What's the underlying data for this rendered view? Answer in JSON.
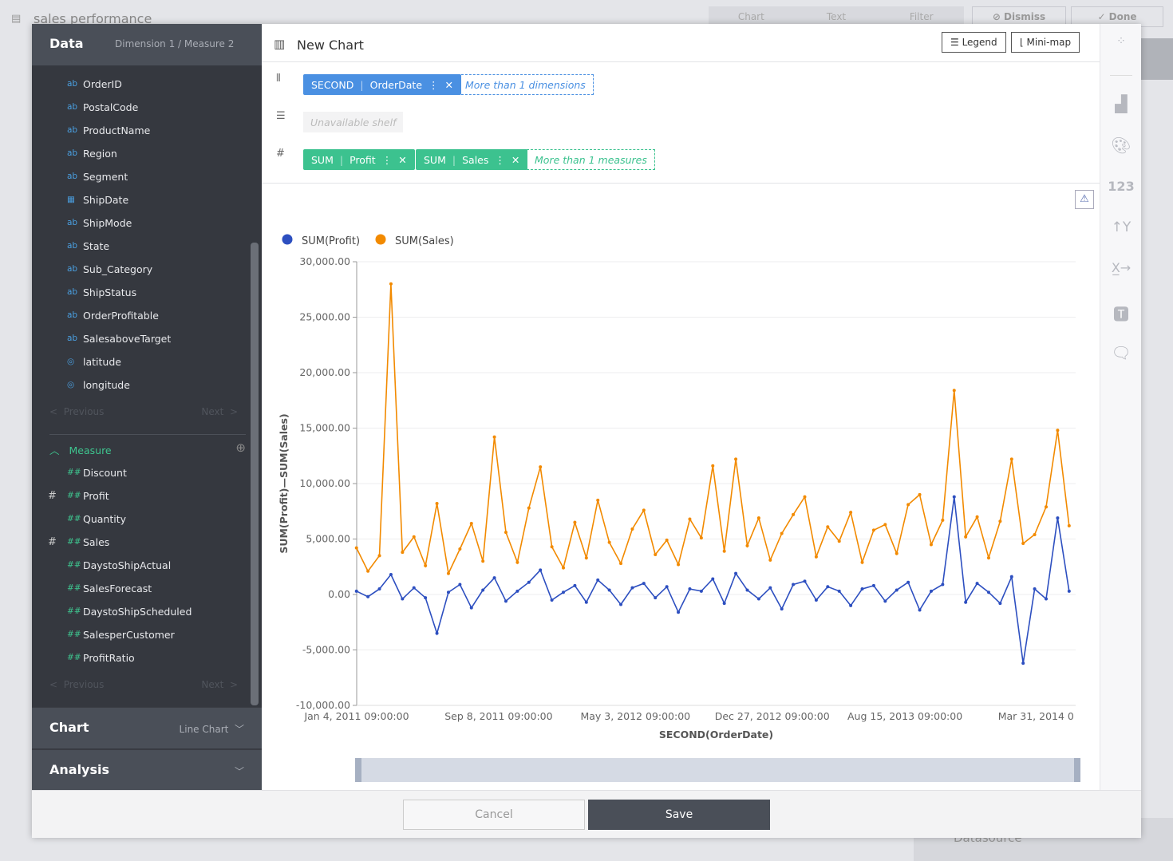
{
  "app": {
    "title": "sales performance",
    "toolbar": [
      "Chart",
      "Text",
      "Filter"
    ],
    "dismiss": "Dismiss",
    "done": "Done",
    "behind_label": "Datasource"
  },
  "data_panel": {
    "title": "Data",
    "summary": "Dimension 1 / Measure 2",
    "dimensions": [
      {
        "type": "ab",
        "name": "OrderID"
      },
      {
        "type": "ab",
        "name": "PostalCode"
      },
      {
        "type": "ab",
        "name": "ProductName"
      },
      {
        "type": "ab",
        "name": "Region"
      },
      {
        "type": "ab",
        "name": "Segment"
      },
      {
        "type": "date",
        "name": "ShipDate"
      },
      {
        "type": "ab",
        "name": "ShipMode"
      },
      {
        "type": "ab",
        "name": "State"
      },
      {
        "type": "ab",
        "name": "Sub_Category"
      },
      {
        "type": "ab",
        "name": "ShipStatus"
      },
      {
        "type": "ab",
        "name": "OrderProfitable"
      },
      {
        "type": "ab",
        "name": "SalesaboveTarget"
      },
      {
        "type": "geo",
        "name": "latitude"
      },
      {
        "type": "geo",
        "name": "longitude"
      }
    ],
    "previous": "Previous",
    "next": "Next",
    "measure_title": "Measure",
    "measures": [
      {
        "name": "Discount",
        "used": false
      },
      {
        "name": "Profit",
        "used": true
      },
      {
        "name": "Quantity",
        "used": false
      },
      {
        "name": "Sales",
        "used": true
      },
      {
        "name": "DaystoShipActual",
        "used": false
      },
      {
        "name": "SalesForecast",
        "used": false
      },
      {
        "name": "DaystoShipScheduled",
        "used": false
      },
      {
        "name": "SalesperCustomer",
        "used": false
      },
      {
        "name": "ProfitRatio",
        "used": false
      }
    ],
    "type_icons": {
      "ab": "ab",
      "date": "▦",
      "geo": "◎",
      "measure": "##"
    }
  },
  "chart_section": {
    "title": "Chart",
    "value": "Line Chart"
  },
  "analysis_section": {
    "title": "Analysis"
  },
  "editor": {
    "title": "New Chart",
    "legend_btn": "Legend",
    "minimap_btn": "Mini-map",
    "columns": {
      "pill": {
        "agg": "SECOND",
        "field": "OrderDate"
      },
      "hint": "More than 1 dimensions"
    },
    "rows": {
      "hint": "Unavailable shelf"
    },
    "measures": {
      "pills": [
        {
          "agg": "SUM",
          "field": "Profit"
        },
        {
          "agg": "SUM",
          "field": "Sales"
        }
      ],
      "hint": "More than 1 measures"
    }
  },
  "colors": {
    "dimension": "#4a90e2",
    "measure": "#3cc28f",
    "profit": "#2d4fc0",
    "sales": "#f28a00"
  },
  "chart_data": {
    "type": "line",
    "xlabel": "SECOND(OrderDate)",
    "ylabel": "SUM(Profit)—SUM(Sales)",
    "ylim": [
      -10000,
      30000
    ],
    "xlim": [
      "2011-01-04T09:00:00",
      "2014-06-08T09:00:00"
    ],
    "y_ticks": [
      "30,000.00",
      "25,000.00",
      "20,000.00",
      "15,000.00",
      "10,000.00",
      "5,000.00",
      "0.00",
      "-5,000.00",
      "-10,000.00"
    ],
    "y_tick_values": [
      30000,
      25000,
      20000,
      15000,
      10000,
      5000,
      0,
      -5000,
      -10000
    ],
    "x_ticks": [
      {
        "date": "2011-01-04T09:00:00",
        "label": "Jan 4, 2011 09:00:00"
      },
      {
        "date": "2011-09-08T09:00:00",
        "label": "Sep 8, 2011 09:00:00"
      },
      {
        "date": "2012-05-03T09:00:00",
        "label": "May 3, 2012 09:00:00"
      },
      {
        "date": "2012-12-27T09:00:00",
        "label": "Dec 27, 2012 09:00:00"
      },
      {
        "date": "2013-08-15T09:00:00",
        "label": "Aug 15, 2013 09:00:00"
      },
      {
        "date": "2014-03-31T09:00:00",
        "label": "Mar 31, 2014 0"
      }
    ],
    "grid": true,
    "legend_placement": "top-left",
    "x": [
      "2011-01-04",
      "2011-01-24",
      "2011-02-13",
      "2011-03-05",
      "2011-03-25",
      "2011-04-14",
      "2011-05-04",
      "2011-05-24",
      "2011-06-13",
      "2011-07-03",
      "2011-07-23",
      "2011-08-12",
      "2011-09-01",
      "2011-09-21",
      "2011-10-11",
      "2011-10-31",
      "2011-11-20",
      "2011-12-10",
      "2011-12-30",
      "2012-01-19",
      "2012-02-08",
      "2012-02-28",
      "2012-03-19",
      "2012-04-08",
      "2012-04-28",
      "2012-05-18",
      "2012-06-07",
      "2012-06-27",
      "2012-07-17",
      "2012-08-06",
      "2012-08-26",
      "2012-09-15",
      "2012-10-05",
      "2012-10-25",
      "2012-11-14",
      "2012-12-04",
      "2012-12-24",
      "2013-01-13",
      "2013-02-02",
      "2013-02-22",
      "2013-03-14",
      "2013-04-03",
      "2013-04-23",
      "2013-05-13",
      "2013-06-02",
      "2013-06-22",
      "2013-07-12",
      "2013-08-01",
      "2013-08-21",
      "2013-09-10",
      "2013-09-30",
      "2013-10-20",
      "2013-11-09",
      "2013-11-29",
      "2013-12-19",
      "2014-01-08",
      "2014-01-28",
      "2014-02-17",
      "2014-03-09",
      "2014-03-29",
      "2014-04-18",
      "2014-05-08",
      "2014-05-28"
    ],
    "series": [
      {
        "name": "SUM(Profit)",
        "values": [
          300,
          -200,
          500,
          1800,
          -400,
          600,
          -300,
          -3500,
          200,
          900,
          -1200,
          400,
          1500,
          -600,
          300,
          1100,
          2200,
          -500,
          200,
          800,
          -700,
          1300,
          400,
          -900,
          600,
          1000,
          -300,
          700,
          -1600,
          500,
          300,
          1400,
          -800,
          1900,
          400,
          -400,
          600,
          -1300,
          900,
          1200,
          -500,
          700,
          300,
          -1000,
          500,
          800,
          -600,
          400,
          1100,
          -1400,
          300,
          900,
          8800,
          -700,
          1000,
          200,
          -800,
          1600,
          -6200,
          500,
          -400,
          6900,
          300
        ]
      },
      {
        "name": "SUM(Sales)",
        "values": [
          4200,
          2100,
          3500,
          28000,
          3800,
          5200,
          2600,
          8200,
          1900,
          4100,
          6400,
          3000,
          14200,
          5600,
          2900,
          7800,
          11500,
          4300,
          2400,
          6500,
          3300,
          8500,
          4700,
          2800,
          5900,
          7600,
          3600,
          4900,
          2700,
          6800,
          5100,
          11600,
          3900,
          12200,
          4400,
          6900,
          3100,
          5500,
          7200,
          8800,
          3400,
          6100,
          4800,
          7400,
          2900,
          5800,
          6300,
          3700,
          8100,
          9000,
          4500,
          6700,
          18400,
          5200,
          7000,
          3300,
          6600,
          12200,
          4600,
          5400,
          7900,
          14800,
          6200
        ]
      }
    ]
  },
  "footer": {
    "cancel": "Cancel",
    "save": "Save"
  },
  "right_toolbar": [
    "filter-icon",
    "chart-type-icon",
    "color-icon",
    "number-format-icon",
    "y-axis-icon",
    "x-axis-icon",
    "text-icon",
    "comment-icon"
  ]
}
